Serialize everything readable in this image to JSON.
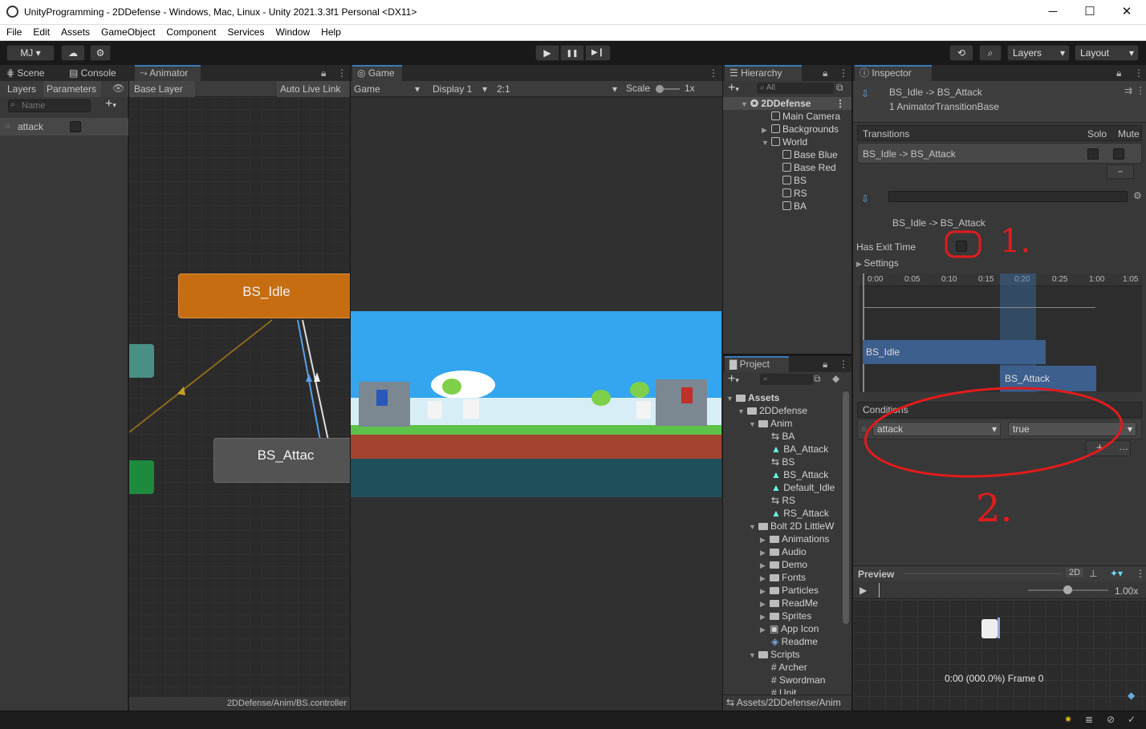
{
  "window": {
    "title": "UnityProgramming - 2DDefense - Windows, Mac, Linux - Unity 2021.3.3f1 Personal <DX11>",
    "minimize": "─",
    "maximize": "☐",
    "close": "✕"
  },
  "menu": [
    "File",
    "Edit",
    "Assets",
    "GameObject",
    "Component",
    "Services",
    "Window",
    "Help"
  ],
  "toolbar": {
    "account": "MJ",
    "play": "▶",
    "pause": "❚❚",
    "step": "▶❙",
    "layers": "Layers",
    "layout": "Layout"
  },
  "left_tabs": {
    "scene": "Scene",
    "console": "Console",
    "animator": "Animator"
  },
  "animator": {
    "layers_tab": "Layers",
    "params_tab": "Parameters",
    "search_placeholder": "Name",
    "base_layer": "Base Layer",
    "auto_live_link": "Auto Live Link",
    "param_name": "attack",
    "state_idle": "BS_Idle",
    "state_attack": "BS_Attac",
    "footer": "2DDefense/Anim/BS.controller"
  },
  "game": {
    "tab": "Game",
    "display_mode": "Game",
    "display": "Display 1",
    "aspect": "2:1",
    "scale_label": "Scale",
    "scale_value": "1x"
  },
  "hierarchy": {
    "tab": "Hierarchy",
    "search_placeholder": "All",
    "root": "2DDefense",
    "items": [
      "Main Camera",
      "Backgrounds",
      "World",
      "Base Blue",
      "Base Red",
      "BS",
      "RS",
      "BA"
    ]
  },
  "project": {
    "tab": "Project",
    "items": [
      "Assets",
      "2DDefense",
      "Anim",
      "BA",
      "BA_Attack",
      "BS",
      "BS_Attack",
      "Default_Idle",
      "RS",
      "RS_Attack",
      "Bolt 2D LittleW",
      "Animations",
      "Audio",
      "Demo",
      "Fonts",
      "Particles",
      "ReadMe",
      "Sprites",
      "App Icon",
      "Readme",
      "Scripts",
      "Archer",
      "Swordman",
      "Unit"
    ],
    "footer": "Assets/2DDefense/Anim"
  },
  "inspector": {
    "tab": "Inspector",
    "header_title": "BS_Idle -> BS_Attack",
    "header_sub": "1 AnimatorTransitionBase",
    "transitions_label": "Transitions",
    "solo": "Solo",
    "mute": "Mute",
    "transition_row": "BS_Idle -> BS_Attack",
    "minus": "−",
    "transition_name": "BS_Idle -> BS_Attack",
    "has_exit_time": "Has Exit Time",
    "settings": "Settings",
    "ticks": [
      "0:00",
      "0:05",
      "0:10",
      "0:15",
      "0:20",
      "0:25",
      "1:00",
      "1:05"
    ],
    "bar_idle": "BS_Idle",
    "bar_attack": "BS_Attack",
    "conditions": "Conditions",
    "cond_param": "attack",
    "cond_value": "true",
    "plus": "+",
    "preview": "Preview",
    "preview_2d": "2D",
    "preview_speed": "1.00x",
    "preview_time": "0:00 (000.0%) Frame 0"
  },
  "annotations": {
    "one": "1.",
    "two": "2."
  }
}
